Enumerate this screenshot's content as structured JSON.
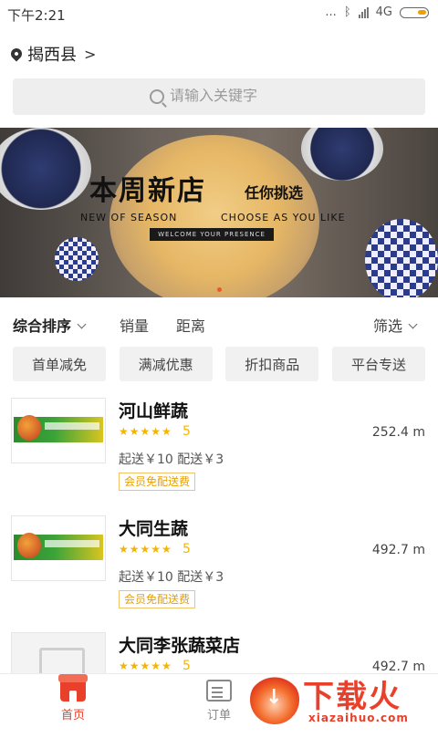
{
  "status_bar": {
    "time": "下午2:21",
    "dots": "...",
    "network": "4G"
  },
  "location": {
    "city": "揭西县",
    "chevron": ">"
  },
  "search": {
    "placeholder": "请输入关键字"
  },
  "banner": {
    "title": "本周新店",
    "subtitle": "任你挑选",
    "english_left": "NEW OF SEASON",
    "english_right": "CHOOSE AS YOU LIKE",
    "welcome": "WELCOME YOUR PRESENCE"
  },
  "sort_bar": {
    "items": [
      "综合排序",
      "销量",
      "距离",
      "筛选"
    ]
  },
  "filter_chips": [
    "首单减免",
    "满减优惠",
    "折扣商品",
    "平台专送"
  ],
  "stores": [
    {
      "name": "河山鲜蔬",
      "stars": "★★★★★",
      "rating": "5",
      "distance": "252.4 m",
      "fees": "起送￥10  配送￥3",
      "badge": "会员免配送费",
      "thumb": "produce-banner"
    },
    {
      "name": "大同生蔬",
      "stars": "★★★★★",
      "rating": "5",
      "distance": "492.7 m",
      "fees": "起送￥10  配送￥3",
      "badge": "会员免配送费",
      "thumb": "produce-banner"
    },
    {
      "name": "大同李张蔬菜店",
      "stars": "★★★★★",
      "rating": "5",
      "distance": "492.7 m",
      "fees": "",
      "badge": "",
      "thumb": "store-placeholder"
    }
  ],
  "bottom_nav": [
    {
      "label": "首页",
      "icon": "store-home-icon",
      "active": true,
      "color": "#e8402a"
    },
    {
      "label": "订单",
      "icon": "order-list-icon",
      "active": false,
      "color": "#888888"
    }
  ],
  "watermark": {
    "text": "下载火",
    "url": "xiazaihuo.com"
  },
  "colors": {
    "accent": "#e8402a",
    "star": "#f4b400",
    "badge": "#e8a000"
  }
}
